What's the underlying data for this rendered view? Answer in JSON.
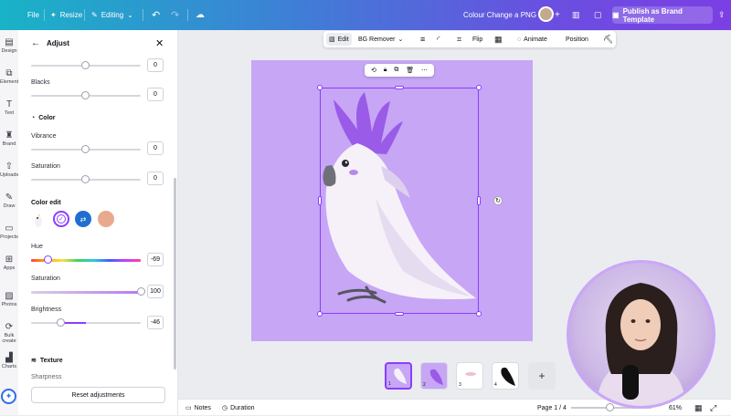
{
  "topbar": {
    "file": "File",
    "resize": "Resize",
    "editing": "Editing",
    "doc_title": "Colour Change a PNG",
    "publish": "Publish as Brand Template"
  },
  "rail": [
    {
      "label": "Design",
      "icon": "design-icon"
    },
    {
      "label": "Elements",
      "icon": "elements-icon"
    },
    {
      "label": "Text",
      "icon": "text-icon"
    },
    {
      "label": "Brand",
      "icon": "brand-icon"
    },
    {
      "label": "Uploads",
      "icon": "uploads-icon"
    },
    {
      "label": "Draw",
      "icon": "draw-icon"
    },
    {
      "label": "Projects",
      "icon": "projects-icon"
    },
    {
      "label": "Apps",
      "icon": "apps-icon"
    },
    {
      "label": "Photos",
      "icon": "photos-icon"
    },
    {
      "label": "Bulk create",
      "icon": "bulk-create-icon"
    },
    {
      "label": "Charts",
      "icon": "charts-icon"
    }
  ],
  "panel": {
    "title": "Adjust",
    "top_value": "0",
    "blacks_label": "Blacks",
    "blacks_value": "0",
    "color_title": "Color",
    "vibrance_label": "Vibrance",
    "vibrance_value": "0",
    "saturation_label": "Saturation",
    "saturation_value": "0",
    "color_edit_title": "Color edit",
    "hue_label": "Hue",
    "hue_value": "-69",
    "hue_level": 0.15,
    "sat2_label": "Saturation",
    "sat2_value": "100",
    "sat2_level": 1.0,
    "brightness_label": "Brightness",
    "brightness_value": "-46",
    "brightness_level": 0.27,
    "texture_title": "Texture",
    "sharpness_label": "Sharpness",
    "reset": "Reset adjustments",
    "swatch_colors": [
      "#ffffff",
      "#8b3dff",
      "#1f6fd0",
      "#e8a98f"
    ]
  },
  "ctxbar": {
    "edit": "Edit",
    "bg_remover": "BG Remover",
    "flip": "Flip",
    "animate": "Animate",
    "position": "Position"
  },
  "pages": {
    "thumb_numbers": [
      "1",
      "2",
      "3",
      "4"
    ]
  },
  "bottombar": {
    "notes": "Notes",
    "duration": "Duration",
    "page": "Page 1 / 4",
    "zoom": "61%"
  },
  "colors": {
    "accent": "#8b3dff",
    "canvas_bg": "#c6a6f5",
    "bird_crest": "#9a5be8"
  }
}
